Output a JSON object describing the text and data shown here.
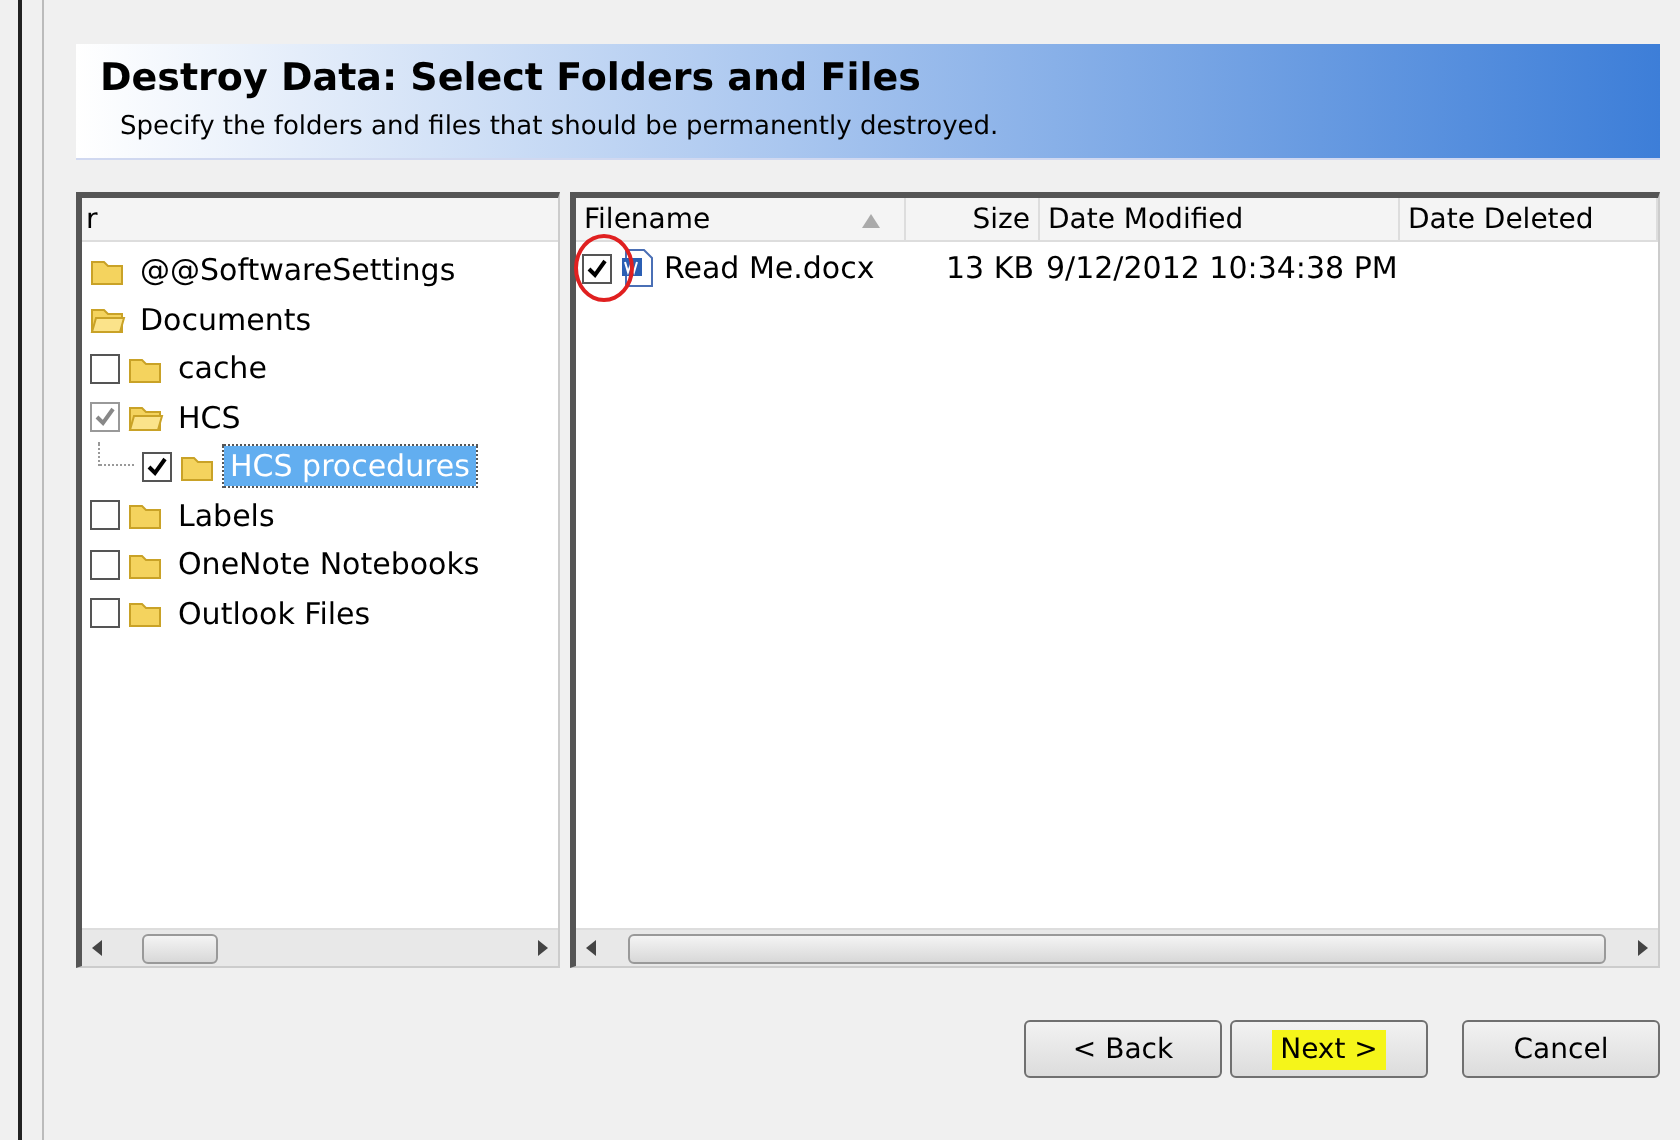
{
  "header": {
    "title": "Destroy Data: Select Folders and Files",
    "subtitle": "Specify the folders and files that should be permanently destroyed."
  },
  "tree": {
    "column_1": "r",
    "items": [
      {
        "label": "@@SoftwareSettings",
        "kind": "folder",
        "selected": false
      },
      {
        "label": "Documents",
        "kind": "folder",
        "selected": false,
        "children": [
          {
            "label": "cache",
            "kind": "checkbox",
            "checked": false,
            "partial": false,
            "selected": false
          },
          {
            "label": "HCS",
            "kind": "checkbox",
            "checked": true,
            "partial": true,
            "selected": false,
            "children": [
              {
                "label": "HCS procedures",
                "kind": "checkbox",
                "checked": true,
                "partial": false,
                "selected": true
              }
            ]
          },
          {
            "label": "Labels",
            "kind": "checkbox",
            "checked": false,
            "partial": false,
            "selected": false
          },
          {
            "label": "OneNote Notebooks",
            "kind": "checkbox",
            "checked": false,
            "partial": false,
            "selected": false
          },
          {
            "label": "Outlook Files",
            "kind": "checkbox",
            "checked": false,
            "partial": false,
            "selected": false
          }
        ]
      }
    ]
  },
  "files": {
    "columns": [
      "Filename",
      "Size",
      "Date Modified",
      "Date Deleted"
    ],
    "rows": [
      {
        "checked": true,
        "circled": true,
        "filename": "Read Me.docx",
        "size": "13 KB",
        "date_modified": "9/12/2012 10:34:38 PM"
      }
    ]
  },
  "buttons": [
    {
      "label": "< Back",
      "highlighted": false
    },
    {
      "label": "Next >",
      "highlighted": true
    },
    {
      "label": "Cancel",
      "highlighted": false
    }
  ]
}
